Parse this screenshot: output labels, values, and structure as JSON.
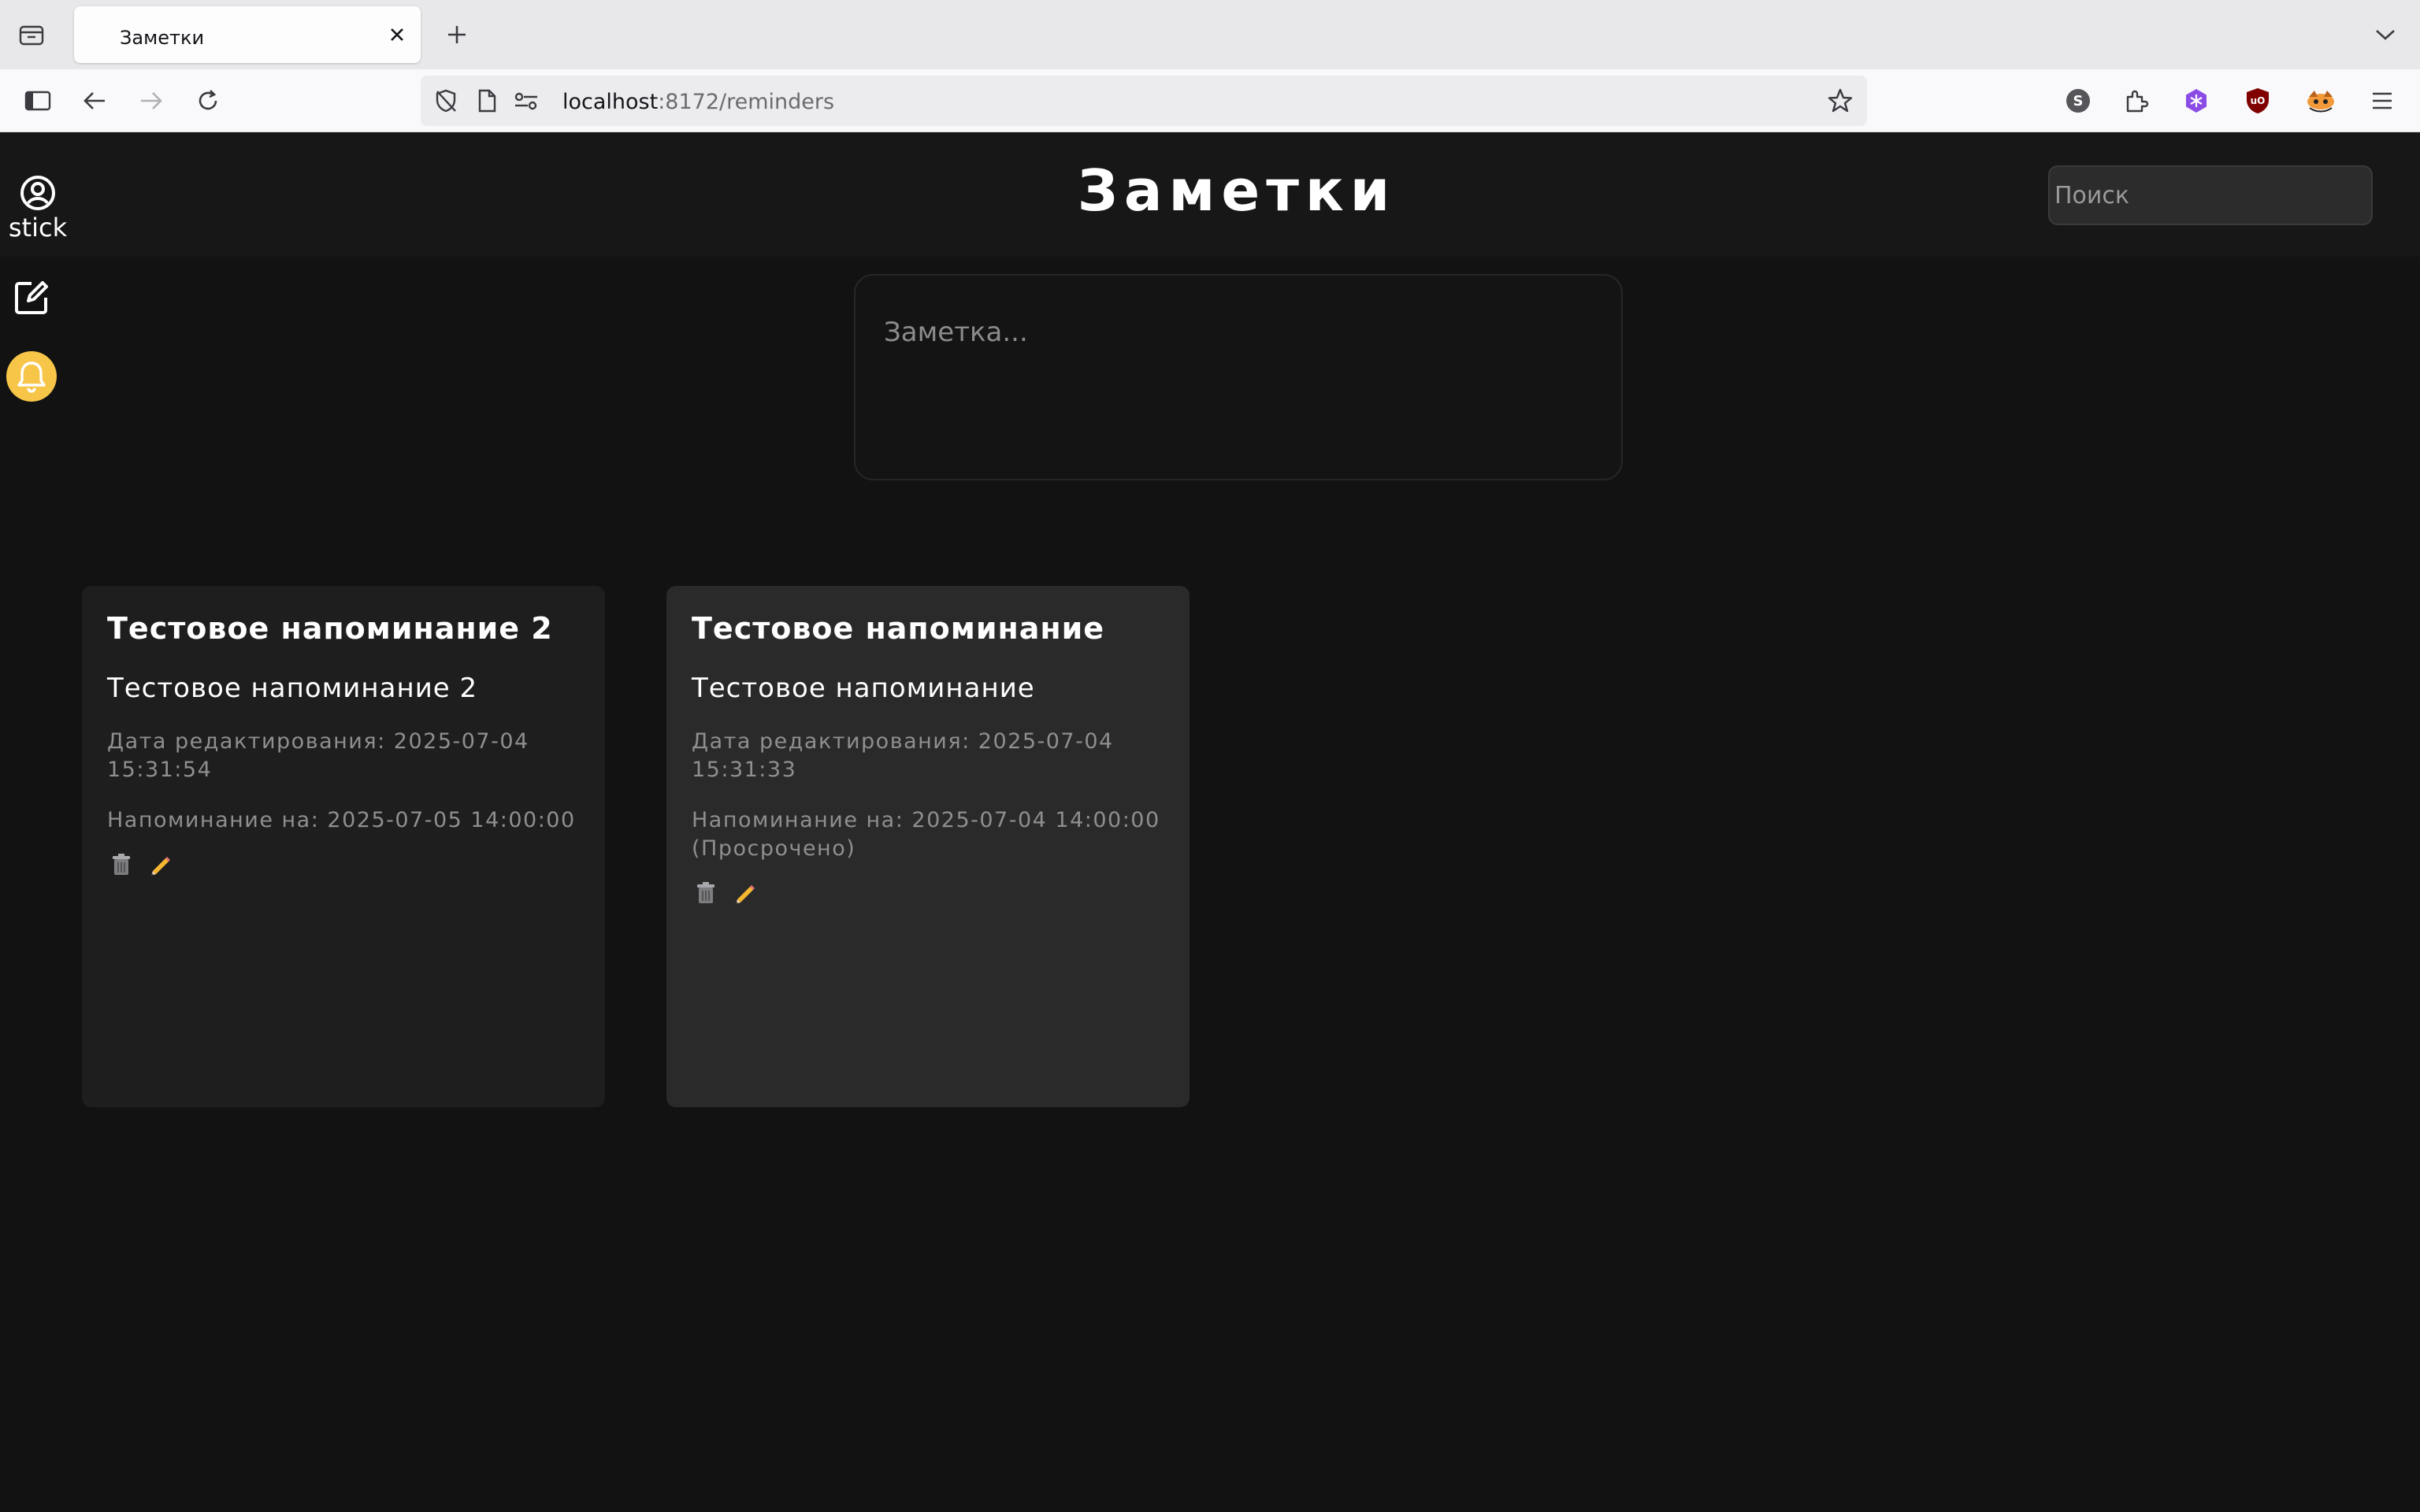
{
  "browser": {
    "tab_title": "Заметки",
    "url_host": "localhost",
    "url_rest": ":8172/reminders"
  },
  "app": {
    "title": "Заметки",
    "search_placeholder": "Поиск",
    "username": "stick",
    "note_placeholder": "Заметка...",
    "bell_color": "#f7c548"
  },
  "cards": [
    {
      "title": "Тестовое напоминание 2",
      "body": "Тестовое напоминание 2",
      "edited": "Дата редактирования: 2025-07-04 15:31:54",
      "reminder": "Напоминание на: 2025-07-05 14:00:00",
      "background": "#1e1e1e"
    },
    {
      "title": "Тестовое напоминание",
      "body": "Тестовое напоминание",
      "edited": "Дата редактирования: 2025-07-04 15:31:33",
      "reminder": "Напоминание на: 2025-07-04 14:00:00 (Просрочено)",
      "background": "#2a2a2a"
    }
  ]
}
